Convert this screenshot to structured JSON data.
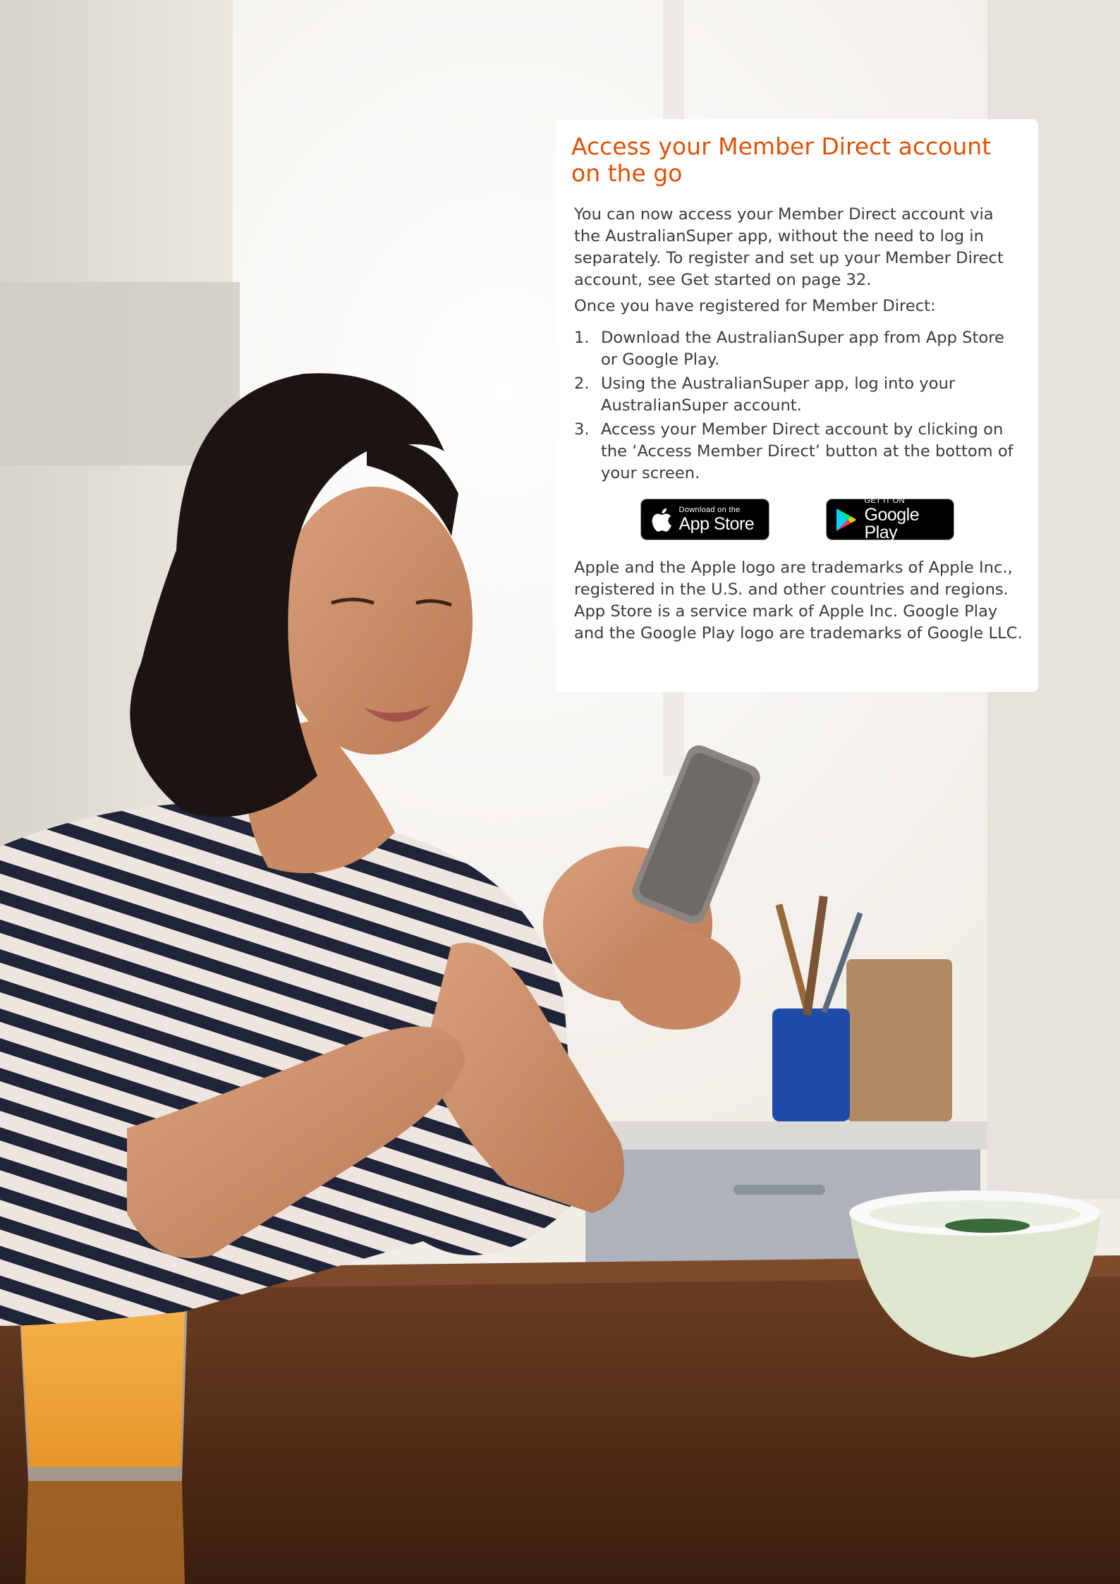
{
  "card": {
    "title": "Access your Member Direct account on the go",
    "intro": "You can now access your Member Direct account via the AustralianSuper app, without the need to log in separately. To register and set up your Member Direct account, see Get started on page 32.",
    "lead": "Once you have registered for Member Direct:",
    "steps": [
      {
        "num": "1.",
        "text": "Download the AustralianSuper app from App Store or Google Play."
      },
      {
        "num": "2.",
        "text": "Using the AustralianSuper app, log into your AustralianSuper account."
      },
      {
        "num": "3.",
        "text": "Access your Member Direct account by clicking on the ‘Access Member Direct’ button at the bottom of your screen."
      }
    ],
    "badges": {
      "app_store": {
        "small": "Download on the",
        "big": "App Store",
        "icon": "apple-icon"
      },
      "google_play": {
        "small": "GET IT ON",
        "big": "Google Play",
        "icon": "google-play-icon"
      }
    },
    "disclaimer": "Apple and the Apple logo are trademarks of Apple Inc., registered in the U.S. and other countries and regions. App Store is a service mark of Apple Inc. Google Play and the Google Play logo are trademarks of Google LLC."
  },
  "colors": {
    "accent": "#e35205",
    "body_text": "#3b3b3b",
    "card_bg": "#ffffff",
    "badge_bg": "#000000"
  }
}
